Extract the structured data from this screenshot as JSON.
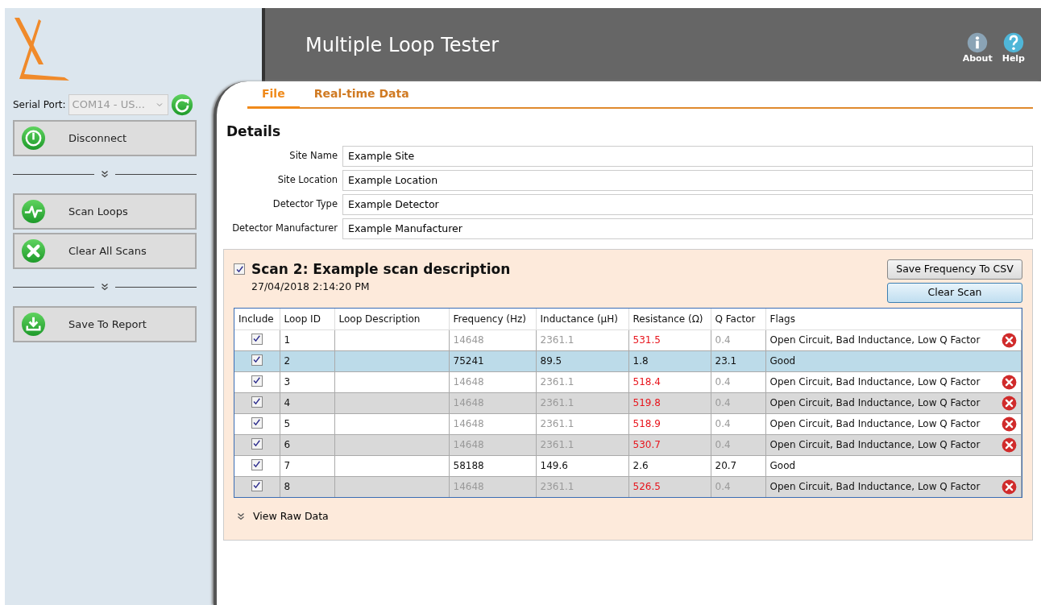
{
  "app": {
    "title": "Multiple Loop Tester"
  },
  "header_buttons": [
    {
      "label": "About",
      "kind": "info"
    },
    {
      "label": "Help",
      "kind": "help"
    }
  ],
  "sidebar": {
    "serial_port": {
      "label": "Serial Port:",
      "value": "COM14 - US..."
    },
    "items": [
      {
        "kind": "button",
        "label": "Disconnect"
      },
      {
        "kind": "separator"
      },
      {
        "kind": "button",
        "label": "Scan Loops"
      },
      {
        "kind": "button",
        "label": "Clear All Scans"
      },
      {
        "kind": "separator"
      },
      {
        "kind": "button",
        "label": "Save To Report"
      }
    ]
  },
  "tabs": [
    {
      "label": "File",
      "selected": true
    },
    {
      "label": "Real-time Data",
      "selected": false
    }
  ],
  "details": {
    "heading": "Details",
    "fields": [
      {
        "label": "Site Name",
        "value": "Example Site"
      },
      {
        "label": "Site Location",
        "value": "Example Location"
      },
      {
        "label": "Detector Type",
        "value": "Example Detector"
      },
      {
        "label": "Detector Manufacturer",
        "value": "Example Manufacturer"
      }
    ]
  },
  "scan": {
    "checked": true,
    "title": "Scan 2: Example scan description",
    "timestamp": "27/04/2018 2:14:20 PM",
    "buttons": [
      {
        "label": "Save Frequency To CSV",
        "focused": false
      },
      {
        "label": "Clear Scan",
        "focused": true
      }
    ],
    "table": {
      "columns": [
        "Include",
        "Loop ID",
        "Loop Description",
        "Frequency (Hz)",
        "Inductance (µH)",
        "Resistance (Ω)",
        "Q Factor",
        "Flags"
      ],
      "rows": [
        {
          "include": true,
          "loop_id": "1",
          "frequency": "14648",
          "inductance": "2361.1",
          "resistance": "531.5",
          "q_factor": "0.4",
          "flags": "Open Circuit, Bad Inductance, Low Q Factor",
          "failed": true,
          "selected": false
        },
        {
          "include": true,
          "loop_id": "2",
          "frequency": "75241",
          "inductance": "89.5",
          "resistance": "1.8",
          "q_factor": "23.1",
          "flags": "Good",
          "failed": false,
          "selected": true
        },
        {
          "include": true,
          "loop_id": "3",
          "frequency": "14648",
          "inductance": "2361.1",
          "resistance": "518.4",
          "q_factor": "0.4",
          "flags": "Open Circuit, Bad Inductance, Low Q Factor",
          "failed": true,
          "selected": false
        },
        {
          "include": true,
          "loop_id": "4",
          "frequency": "14648",
          "inductance": "2361.1",
          "resistance": "519.8",
          "q_factor": "0.4",
          "flags": "Open Circuit, Bad Inductance, Low Q Factor",
          "failed": true,
          "selected": false
        },
        {
          "include": true,
          "loop_id": "5",
          "frequency": "14648",
          "inductance": "2361.1",
          "resistance": "518.9",
          "q_factor": "0.4",
          "flags": "Open Circuit, Bad Inductance, Low Q Factor",
          "failed": true,
          "selected": false
        },
        {
          "include": true,
          "loop_id": "6",
          "frequency": "14648",
          "inductance": "2361.1",
          "resistance": "530.7",
          "q_factor": "0.4",
          "flags": "Open Circuit, Bad Inductance, Low Q Factor",
          "failed": true,
          "selected": false
        },
        {
          "include": true,
          "loop_id": "7",
          "frequency": "58188",
          "inductance": "149.6",
          "resistance": "2.6",
          "q_factor": "20.7",
          "flags": "Good",
          "failed": false,
          "selected": false
        },
        {
          "include": true,
          "loop_id": "8",
          "frequency": "14648",
          "inductance": "2361.1",
          "resistance": "526.5",
          "q_factor": "0.4",
          "flags": "Open Circuit, Bad Inductance, Low Q Factor",
          "failed": true,
          "selected": false
        }
      ]
    },
    "raw_data": {
      "label": "View Raw Data",
      "expanded": false
    }
  }
}
